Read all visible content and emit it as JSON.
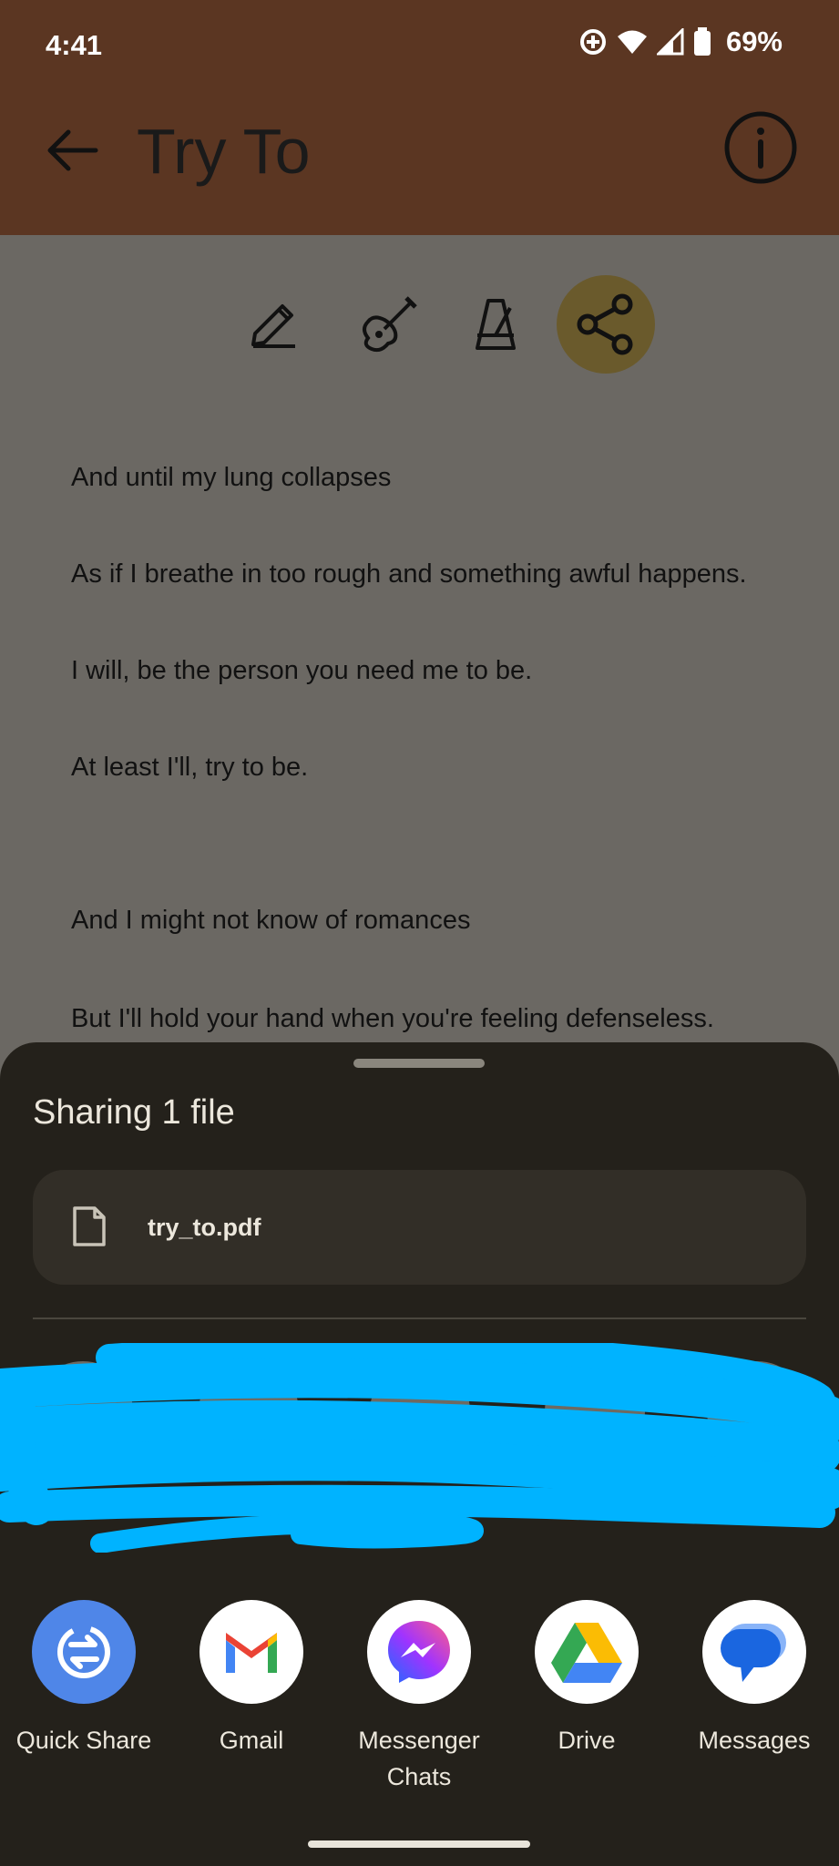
{
  "status_bar": {
    "time": "4:41",
    "battery": "69%"
  },
  "header": {
    "title": "Try To"
  },
  "toolbar": {
    "tools": [
      "edit",
      "chords",
      "metronome",
      "share"
    ]
  },
  "lyrics": [
    "And until my lung collapses",
    "As if I breathe in too rough and something awful happens.",
    "I will, be the person you need me to be.",
    "At least I'll, try to be.",
    "And I might not know of romances",
    "But I'll hold your hand when you're feeling defenseless."
  ],
  "share_sheet": {
    "title": "Sharing 1 file",
    "file_name": "try_to.pdf",
    "apps": [
      {
        "label": "Quick Share",
        "icon": "quick-share-icon"
      },
      {
        "label": "Gmail",
        "icon": "gmail-icon"
      },
      {
        "label": "Messenger Chats",
        "icon": "messenger-icon"
      },
      {
        "label": "Drive",
        "icon": "drive-icon"
      },
      {
        "label": "Messages",
        "icon": "messages-icon"
      }
    ]
  },
  "colors": {
    "app_bar": "#5b3622",
    "sheet_bg": "#24211b",
    "active_tool": "#6a5a2c",
    "scribble": "#00b3ff"
  }
}
